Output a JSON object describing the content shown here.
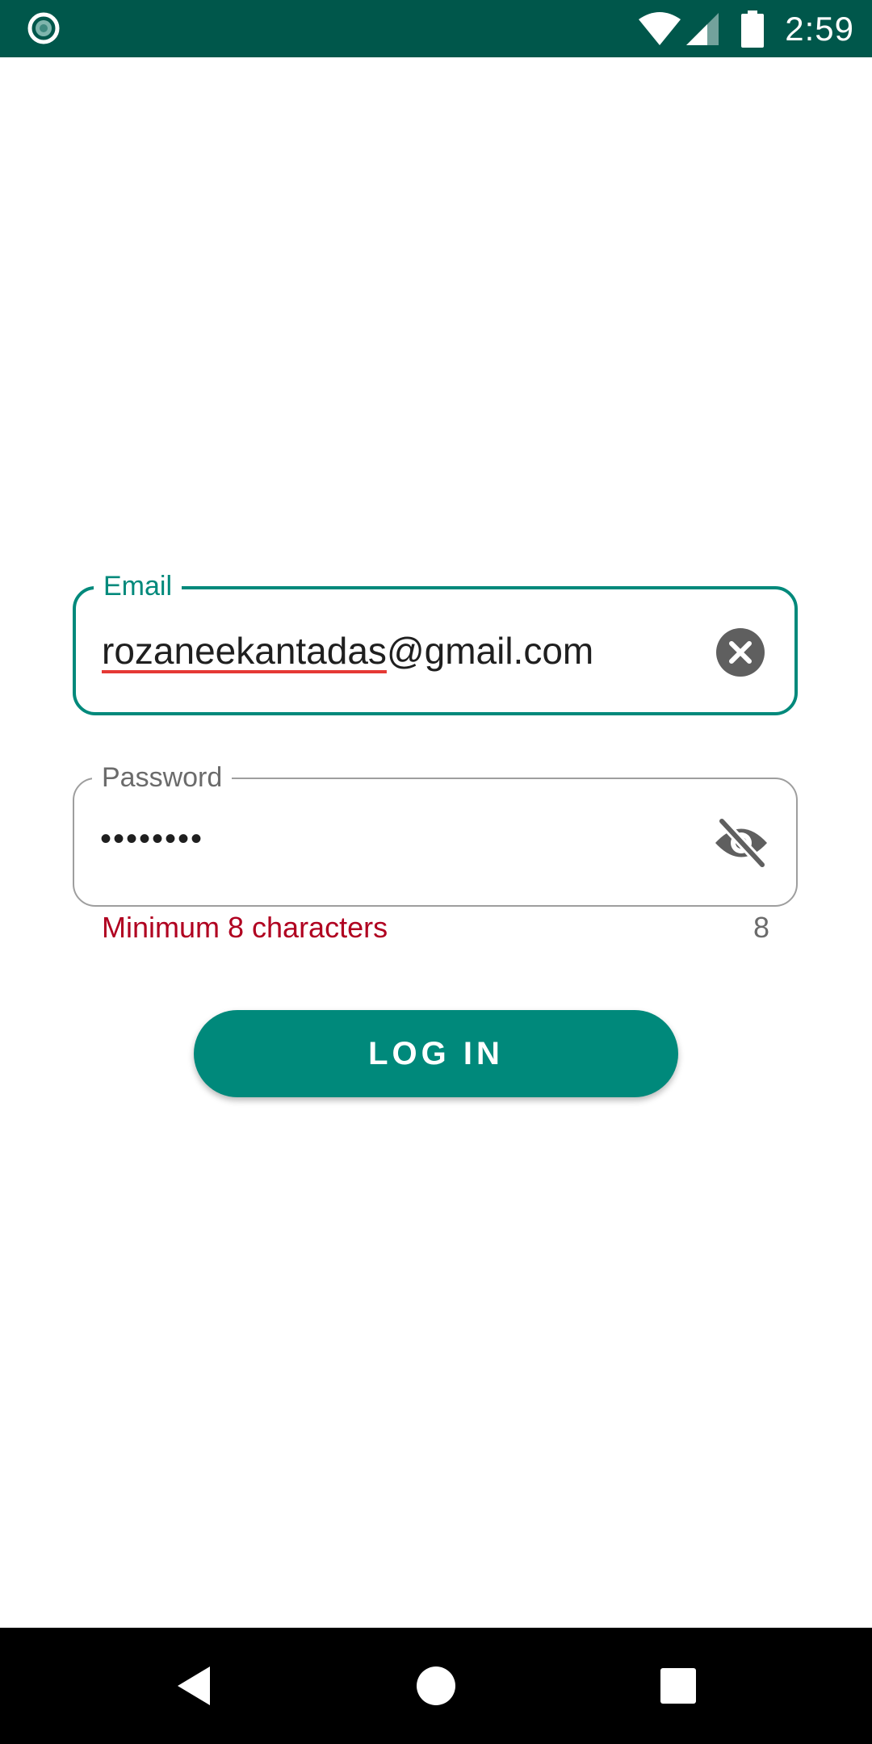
{
  "status_bar": {
    "time": "2:59",
    "icons": [
      "app-notification-icon",
      "wifi-icon",
      "cellular-signal-icon",
      "battery-icon"
    ],
    "background_color": "#00574b"
  },
  "login_form": {
    "email": {
      "label": "Email",
      "value_misspelled": "rozaneekantadas",
      "value_rest": "@gmail.com",
      "trailing_icon": "clear-icon"
    },
    "password": {
      "label": "Password",
      "value": "••••••••",
      "trailing_icon": "visibility-off-icon",
      "helper_text": "Minimum 8 characters",
      "counter": "8"
    },
    "login_button": {
      "label": "LOG IN"
    }
  },
  "nav_bar": {
    "icons": [
      "back-icon",
      "home-icon",
      "recents-icon"
    ]
  },
  "colors": {
    "accent": "#00897b",
    "error": "#b00020",
    "spell_underline": "#e53935"
  }
}
